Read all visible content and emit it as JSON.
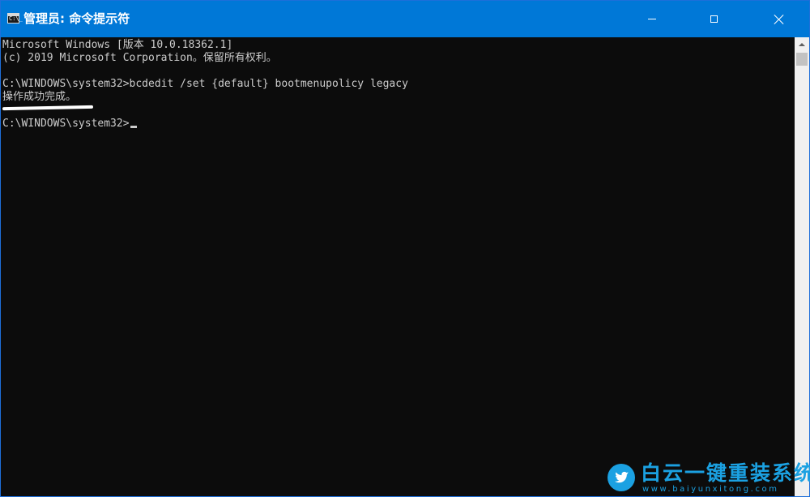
{
  "window": {
    "title": "管理员: 命令提示符",
    "icon": "cmd-icon",
    "icon_prompt": "C:\\_",
    "accent_color": "#0078d7"
  },
  "controls": {
    "minimize": "minimize-icon",
    "maximize": "maximize-icon",
    "close": "close-icon"
  },
  "console": {
    "background": "#0c0c0c",
    "foreground": "#cccccc",
    "lines": [
      "Microsoft Windows [版本 10.0.18362.1]",
      "(c) 2019 Microsoft Corporation。保留所有权利。",
      "C:\\WINDOWS\\system32>bcdedit /set {default} bootmenupolicy legacy",
      "操作成功完成。",
      "C:\\WINDOWS\\system32>"
    ]
  },
  "watermark": {
    "title": "白云一键重装系统",
    "url": "www.baiyunxitong.com",
    "icon": "twitter-bird-icon",
    "color": "#1ba1e2"
  }
}
